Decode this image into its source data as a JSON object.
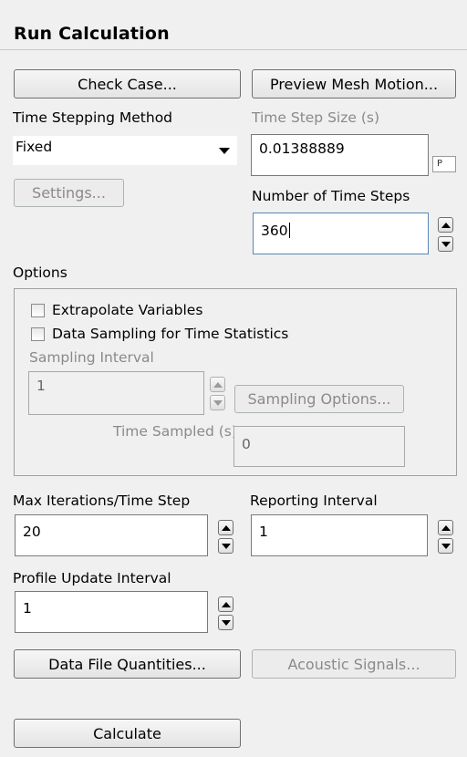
{
  "panel": {
    "title": "Run Calculation"
  },
  "buttons": {
    "check_case": "Check Case...",
    "preview_mesh_motion": "Preview Mesh Motion...",
    "settings": "Settings...",
    "sampling_options": "Sampling Options...",
    "data_file_quantities": "Data File Quantities...",
    "acoustic_signals": "Acoustic Signals...",
    "calculate": "Calculate"
  },
  "time_stepping": {
    "method_label": "Time Stepping Method",
    "method_value": "Fixed",
    "step_size_label": "Time Step Size (s)",
    "step_size_value": "0.01388889",
    "param_badge": "P",
    "num_steps_label": "Number of Time Steps",
    "num_steps_value": "360"
  },
  "options": {
    "label": "Options",
    "extrapolate_label": "Extrapolate Variables",
    "extrapolate_checked": false,
    "data_sampling_label": "Data Sampling for Time Statistics",
    "data_sampling_checked": false,
    "sampling_interval_label": "Sampling Interval",
    "sampling_interval_value": "1",
    "time_sampled_label": "Time Sampled (s)",
    "time_sampled_value": "0"
  },
  "iteration": {
    "max_iter_label": "Max Iterations/Time Step",
    "max_iter_value": "20",
    "reporting_label": "Reporting Interval",
    "reporting_value": "1",
    "profile_label": "Profile Update Interval",
    "profile_value": "1"
  },
  "icons": {
    "dropdown": "chevron-down-icon",
    "spin_up": "arrow-up-icon",
    "spin_down": "arrow-down-icon"
  }
}
